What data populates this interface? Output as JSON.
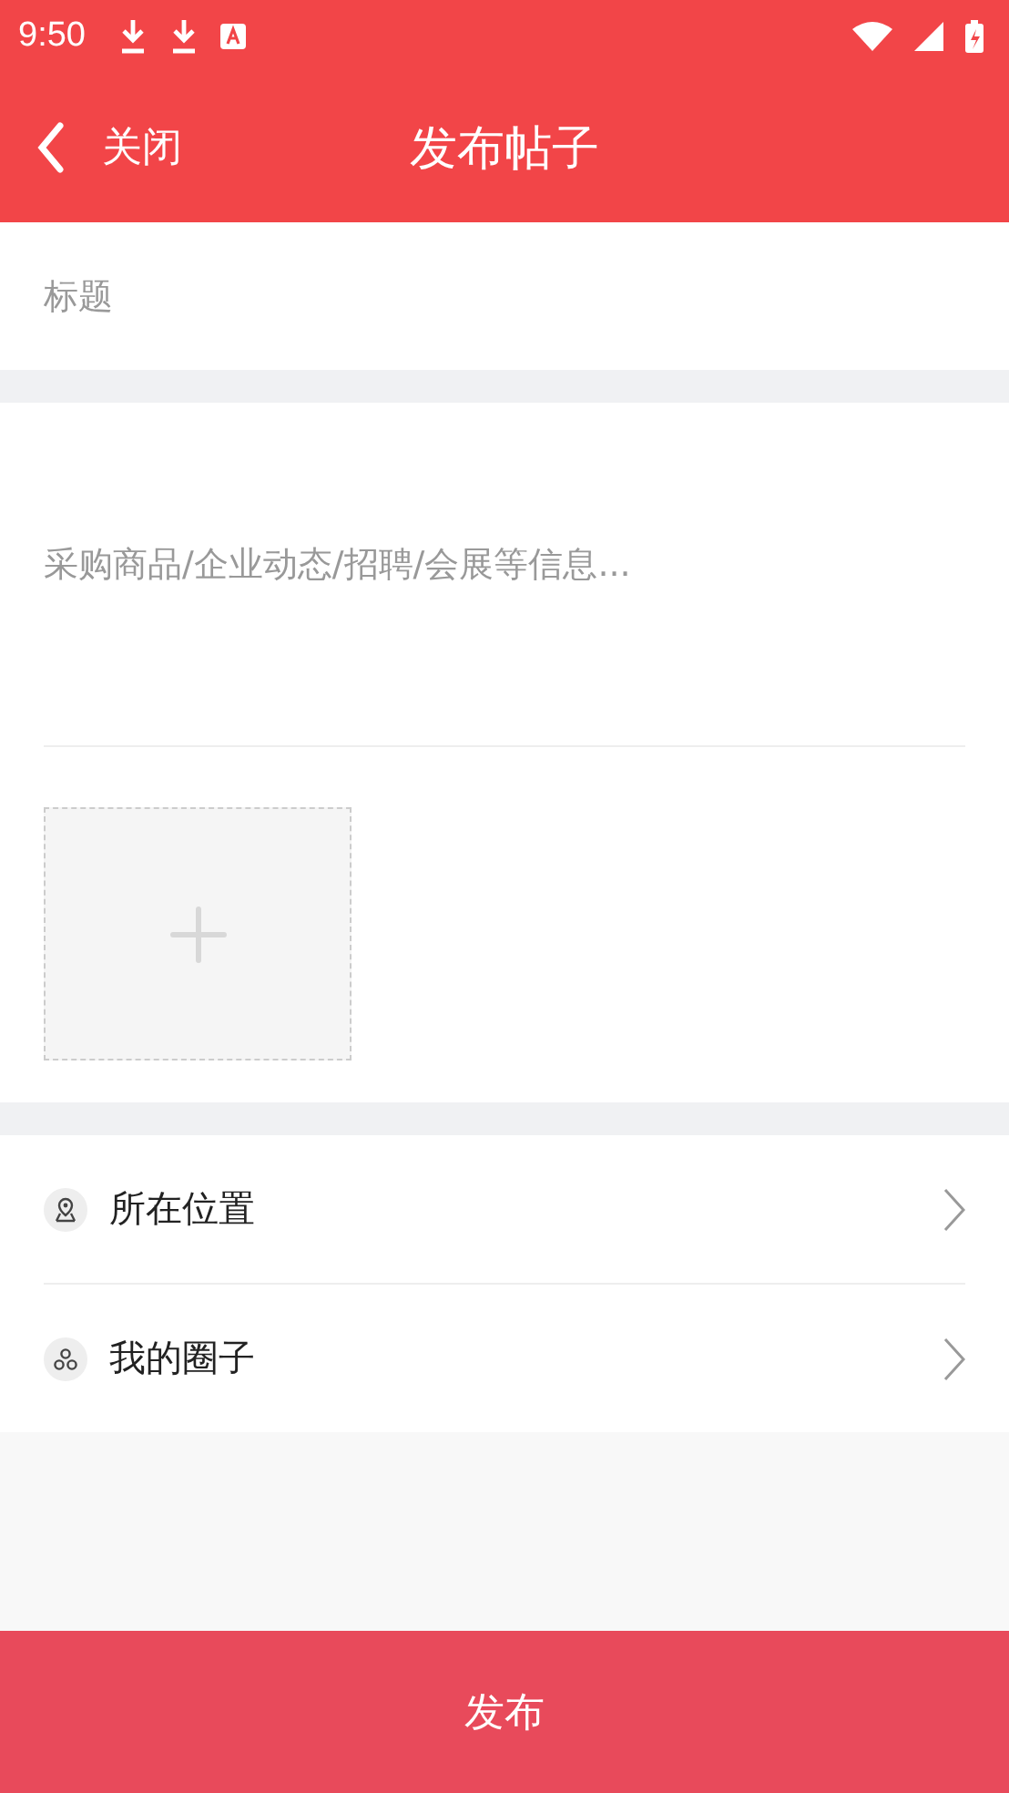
{
  "status_bar": {
    "time": "9:50"
  },
  "header": {
    "back_label": "关闭",
    "title": "发布帖子"
  },
  "title_field": {
    "placeholder": "标题"
  },
  "content_field": {
    "placeholder": "采购商品/企业动态/招聘/会展等信息..."
  },
  "options": [
    {
      "kind": "location",
      "label": "所在位置"
    },
    {
      "kind": "circle",
      "label": "我的圈子"
    }
  ],
  "submit_button": "发布"
}
